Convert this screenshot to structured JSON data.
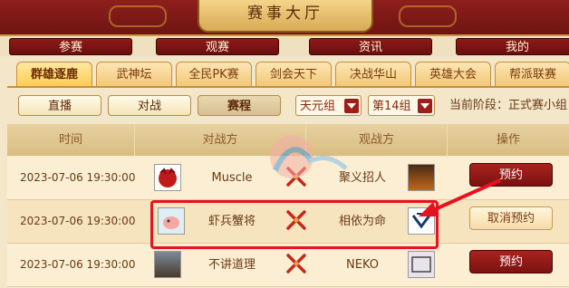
{
  "banner": {
    "title": "赛事大厅"
  },
  "main_tabs": [
    {
      "label": "参赛"
    },
    {
      "label": "观赛"
    },
    {
      "label": "资讯"
    },
    {
      "label": "我的"
    }
  ],
  "sub_tabs": [
    {
      "label": "群雄逐鹿",
      "active": true
    },
    {
      "label": "武神坛"
    },
    {
      "label": "全民PK赛"
    },
    {
      "label": "剑会天下"
    },
    {
      "label": "决战华山"
    },
    {
      "label": "英雄大会"
    },
    {
      "label": "帮派联赛"
    }
  ],
  "filter": {
    "live": "直播",
    "battle": "对战",
    "schedule": "赛程",
    "group_select": "天元组",
    "number_select": "第14组",
    "stage": "当前阶段：正式赛小组"
  },
  "table": {
    "headers": {
      "time": "时间",
      "opponent": "对战方",
      "watch": "观战方",
      "action": "操作"
    },
    "rows": [
      {
        "time": "2023-07-06 19:30:00",
        "team_a": "Muscle",
        "team_b": "聚义招人",
        "action": "预约",
        "action_type": "reserve"
      },
      {
        "time": "2023-07-06 19:30:00",
        "team_a": "虾兵蟹将",
        "team_b": "相依为命",
        "action": "取消预约",
        "action_type": "cancel"
      },
      {
        "time": "2023-07-06 19:30:00",
        "team_a": "不讲道理",
        "team_b": "NEKO",
        "action": "预约",
        "action_type": "reserve"
      }
    ]
  },
  "colors": {
    "accent_red": "#9c1f1a",
    "highlight": "#e8111f",
    "gold": "#ffcc55"
  }
}
